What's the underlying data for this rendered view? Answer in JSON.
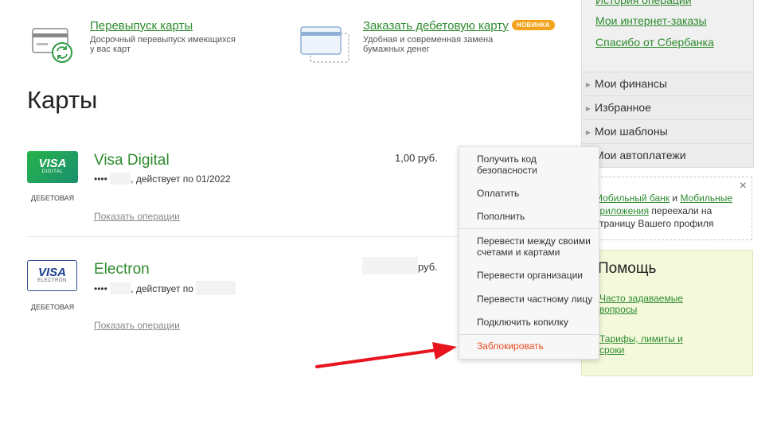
{
  "promos": [
    {
      "title": "Перевыпуск карты",
      "text": "Досрочный перевыпуск имеющихся у вас карт",
      "icon": "card-reissue-icon"
    },
    {
      "title": "Заказать дебетовую карту",
      "badge": "НОВИНКА",
      "text": "Удобная и современная замена бумажных денег",
      "icon": "card-order-icon"
    }
  ],
  "page_title": "Карты",
  "cards": [
    {
      "logo_text": "VISA",
      "logo_sub": "DIGITAL",
      "type": "ДЕБЕТОВАЯ",
      "name": "Visa Digital",
      "number_prefix": "••••",
      "valid_text": ", действует по 01/2022",
      "balance": "1,00 руб.",
      "ops_link": "Показать операции"
    },
    {
      "logo_text": "VISA",
      "logo_sub": "ELECTRON",
      "type": "ДЕБЕТОВАЯ",
      "name": "Electron",
      "number_prefix": "••••",
      "valid_text": ", действует по",
      "currency": "руб.",
      "ops_link": "Показать операции"
    }
  ],
  "menu": {
    "items": [
      "Получить код безопасности",
      "Оплатить",
      "Пополнить",
      "Перевести между своими счетами и картами",
      "Перевести организации",
      "Перевести частному лицу",
      "Подключить копилку",
      "Заблокировать"
    ]
  },
  "sidebar": {
    "top_links": [
      "История операций",
      "Мои интернет-заказы",
      "Спасибо от Сбербанка"
    ],
    "nav": [
      "Мои финансы",
      "Избранное",
      "Мои шаблоны",
      "Мои автоплатежи"
    ],
    "notice": {
      "link1": "Мобильный банк",
      "and": " и ",
      "link2": "Мобильные приложения",
      "rest": " переехали на страницу Вашего профиля",
      "close": "×"
    },
    "help": {
      "title": "Помощь",
      "links": [
        "Часто задаваемые вопросы",
        "Тарифы, лимиты и сроки"
      ]
    }
  },
  "colors": {
    "brand_green": "#2e8b2e",
    "danger": "#e84b22",
    "badge": "#f2a31b",
    "arrow": "#e8141e"
  }
}
